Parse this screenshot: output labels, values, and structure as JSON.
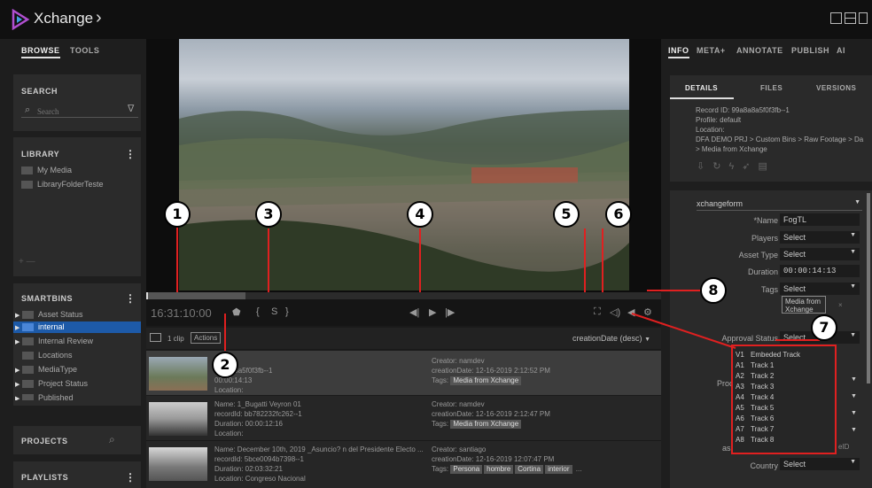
{
  "app": {
    "title": "Xchange"
  },
  "left": {
    "tabs": [
      "BROWSE",
      "TOOLS"
    ],
    "search": {
      "title": "SEARCH",
      "placeholder": "Search"
    },
    "library": {
      "title": "LIBRARY",
      "items": [
        "My Media",
        "LibraryFolderTeste"
      ],
      "footer": "+ —"
    },
    "smartbins": {
      "title": "SMARTBINS",
      "items": [
        "Asset Status",
        "internal",
        "Internal Review",
        "Locations",
        "MediaType",
        "Project Status",
        "Published"
      ]
    },
    "projects": {
      "title": "PROJECTS"
    },
    "playlists": {
      "title": "PLAYLISTS"
    }
  },
  "player": {
    "timecode": "16:31:10:00",
    "mark_in": "{",
    "set": "S",
    "mark_out": "}"
  },
  "clips": {
    "count": "1 clip",
    "actions": "Actions",
    "sort": "creationDate (desc)",
    "rows": [
      {
        "name": "FogTL",
        "id": "99a8a8a5f0f3fb--1",
        "duration": "00:00:14:13",
        "location": "Location:",
        "creator": "Creator: namdev",
        "date": "creationDate: 12-16-2019 2:12:52 PM",
        "tags_label": "Tags:",
        "tags": [
          "Media from Xchange"
        ]
      },
      {
        "name": "Name: 1_Bugatti Veyron 01",
        "id": "recordId: bb782232fc262--1",
        "duration": "Duration: 00:00:12:16",
        "location": "Location:",
        "creator": "Creator: namdev",
        "date": "creationDate: 12-16-2019 2:12:47 PM",
        "tags_label": "Tags:",
        "tags": [
          "Media from Xchange"
        ]
      },
      {
        "name": "Name: December 10th, 2019 _Asuncio? n del Presidente Electo ...",
        "id": "recordId: 5bce0094b7398--1",
        "duration": "Duration: 02:03:32:21",
        "location": "Location: Congreso Nacional",
        "creator": "Creator: santiago",
        "date": "creationDate: 12-16-2019 12:07:47 PM",
        "tags_label": "Tags:",
        "tags": [
          "Persona",
          "hombre",
          "Cortina",
          "interior"
        ],
        "more": "..."
      }
    ]
  },
  "right": {
    "tabs": [
      "INFO",
      "META+",
      "ANNOTATE",
      "PUBLISH",
      "AI"
    ],
    "subtabs": [
      "DETAILS",
      "FILES",
      "VERSIONS"
    ],
    "details": [
      "Record ID:  99a8a8a5f0f3fb--1",
      "Profile:  default",
      "Location:",
      "DFA DEMO PRJ > Custom Bins > Raw Footage > Da",
      "> Media from Xchange"
    ],
    "form": {
      "name": "xchangeform",
      "fields": [
        {
          "label": "*Name",
          "value": "FogTL"
        },
        {
          "label": "Players",
          "value": "Select"
        },
        {
          "label": "Asset Type",
          "value": "Select"
        },
        {
          "label": "Duration",
          "value": "00:00:14:13"
        },
        {
          "label": "Tags",
          "value": "Select"
        }
      ],
      "tag_chip": "Media from Xchange",
      "approval": {
        "label": "Approval Status",
        "value": "Select"
      },
      "partial_label_1": "Proc",
      "partial_label_2": "as",
      "partial_value": "eID",
      "country": {
        "label": "Country",
        "value": "Select"
      }
    },
    "tracks": [
      [
        "V1",
        "Embeded Track"
      ],
      [
        "A1",
        "Track 1"
      ],
      [
        "A2",
        "Track 2"
      ],
      [
        "A3",
        "Track 3"
      ],
      [
        "A4",
        "Track 4"
      ],
      [
        "A5",
        "Track 5"
      ],
      [
        "A6",
        "Track 6"
      ],
      [
        "A7",
        "Track 7"
      ],
      [
        "A8",
        "Track 8"
      ]
    ]
  },
  "callouts": [
    "1",
    "2",
    "3",
    "4",
    "5",
    "6",
    "7",
    "8"
  ],
  "colors": {
    "accent": "#1d5aa8",
    "callout_line": "#e02020"
  }
}
